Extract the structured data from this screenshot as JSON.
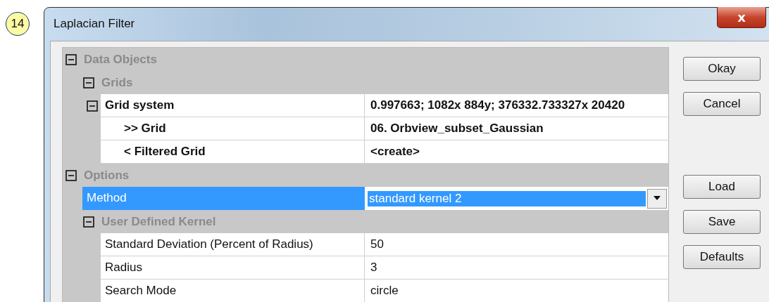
{
  "badge": "14",
  "window": {
    "title": "Laplacian Filter",
    "close": "x"
  },
  "property_grid": {
    "items": [
      {
        "kind": "category",
        "label": "Data Objects",
        "expanded": true,
        "children": [
          {
            "kind": "category",
            "label": "Grids",
            "expanded": true,
            "children": [
              {
                "kind": "group",
                "label": "Grid system",
                "value": "0.997663; 1082x 884y; 376332.733327x 20420",
                "expanded": true,
                "selected": false,
                "children": [
                  {
                    "kind": "property",
                    "label": ">> Grid",
                    "value": "06. Orbview_subset_Gaussian",
                    "selected": false
                  },
                  {
                    "kind": "property",
                    "label": "< Filtered Grid",
                    "value": "<create>",
                    "selected": false
                  }
                ]
              }
            ]
          }
        ]
      },
      {
        "kind": "category",
        "label": "Options",
        "expanded": true,
        "children": [
          {
            "kind": "dropdown",
            "label": "Method",
            "value": "standard kernel 2",
            "selected": true
          },
          {
            "kind": "category",
            "label": "User Defined Kernel",
            "expanded": true,
            "children": [
              {
                "kind": "property",
                "label": "Standard Deviation (Percent of Radius)",
                "value": "50",
                "selected": false
              },
              {
                "kind": "property",
                "label": "Radius",
                "value": "3",
                "selected": false
              },
              {
                "kind": "property",
                "label": "Search Mode",
                "value": "circle",
                "selected": false
              }
            ]
          }
        ]
      }
    ]
  },
  "buttons": [
    "Okay",
    "Cancel",
    "Load",
    "Save",
    "Defaults"
  ]
}
